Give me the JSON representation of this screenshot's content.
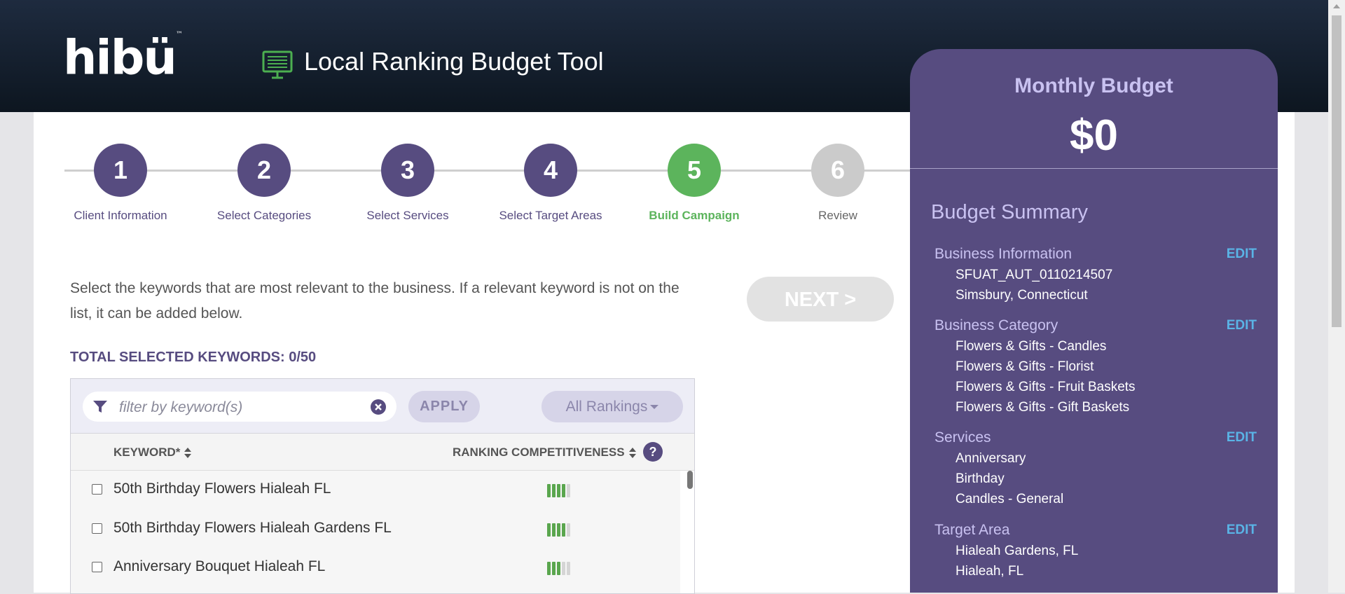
{
  "app": {
    "logo": "hibü",
    "logo_tm": "™",
    "title": "Local Ranking Budget Tool",
    "icon": "monitor-icon"
  },
  "steps": [
    {
      "number": "1",
      "label": "Client Information",
      "state": "done"
    },
    {
      "number": "2",
      "label": "Select Categories",
      "state": "done"
    },
    {
      "number": "3",
      "label": "Select Services",
      "state": "done"
    },
    {
      "number": "4",
      "label": "Select Target Areas",
      "state": "done"
    },
    {
      "number": "5",
      "label": "Build Campaign",
      "state": "active"
    },
    {
      "number": "6",
      "label": "Review",
      "state": "future"
    }
  ],
  "main": {
    "intro": "Select the keywords that are most relevant to the business. If a relevant keyword is not on the list, it can be added below.",
    "next_label": "NEXT >",
    "total_label": "TOTAL SELECTED KEYWORDS: 0/50"
  },
  "filter": {
    "placeholder": "filter by keyword(s)",
    "value": "",
    "apply_label": "APPLY",
    "rankings_label": "All Rankings"
  },
  "table": {
    "col_keyword": "KEYWORD*",
    "col_ranking": "RANKING COMPETITIVENESS",
    "help": "?",
    "rows": [
      {
        "keyword": "50th Birthday Flowers Hialeah FL",
        "checked": false,
        "competitiveness": 4,
        "max": 5
      },
      {
        "keyword": "50th Birthday Flowers Hialeah Gardens FL",
        "checked": false,
        "competitiveness": 4,
        "max": 5
      },
      {
        "keyword": "Anniversary Bouquet Hialeah FL",
        "checked": false,
        "competitiveness": 3,
        "max": 5
      }
    ]
  },
  "budget": {
    "title": "Monthly Budget",
    "amount": "$0",
    "summary_title": "Budget Summary",
    "edit_label": "EDIT",
    "sections": [
      {
        "heading": "Business Information",
        "items": [
          "SFUAT_AUT_0110214507",
          "Simsbury, Connecticut"
        ]
      },
      {
        "heading": "Business Category",
        "items": [
          "Flowers & Gifts - Candles",
          "Flowers & Gifts - Florist",
          "Flowers & Gifts - Fruit Baskets",
          "Flowers & Gifts - Gift Baskets"
        ]
      },
      {
        "heading": "Services",
        "items": [
          "Anniversary",
          "Birthday",
          "Candles - General"
        ]
      },
      {
        "heading": "Target Area",
        "items": [
          "Hialeah Gardens, FL",
          "Hialeah, FL"
        ]
      }
    ]
  },
  "colors": {
    "brand_purple": "#574c80",
    "active_green": "#5cb45c",
    "edit_blue": "#5ab4e6",
    "header_dark": "#0d1620"
  }
}
